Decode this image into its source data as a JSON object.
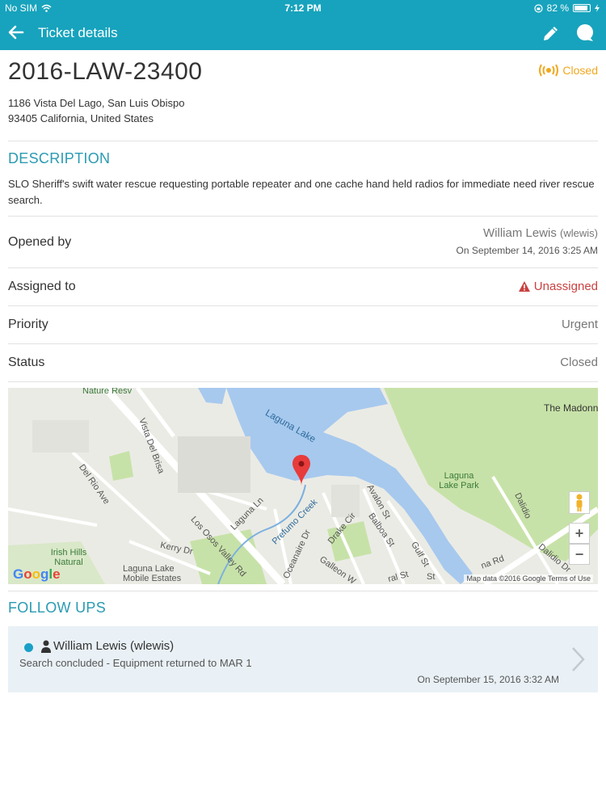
{
  "status_bar": {
    "carrier": "No SIM",
    "time": "7:12 PM",
    "battery": "82 %"
  },
  "app_bar": {
    "title": "Ticket details"
  },
  "ticket": {
    "id": "2016-LAW-23400",
    "status_badge": "Closed",
    "address_line1": "1186 Vista Del Lago, San Luis Obispo",
    "address_line2": "93405 California, United States"
  },
  "description": {
    "title": "DESCRIPTION",
    "text": "SLO Sheriff's swift water rescue requesting portable repeater and one cache hand held radios for immediate need river rescue search."
  },
  "details": {
    "opened_by_label": "Opened by",
    "opened_by_name": "William Lewis",
    "opened_by_handle": "(wlewis)",
    "opened_on": "On September 14, 2016 3:25 AM",
    "assigned_to_label": "Assigned to",
    "assigned_to_value": "Unassigned",
    "priority_label": "Priority",
    "priority_value": "Urgent",
    "status_label": "Status",
    "status_value": "Closed"
  },
  "map": {
    "labels": {
      "nature": "Nature Resv",
      "vista": "Vista Del Brisa",
      "delrio": "Del Rio Ave",
      "laguna_lake": "Laguna Lake",
      "laguna_ln": "Laguna Ln",
      "los_osos": "Los Osos Valley Rd",
      "prefumo": "Prefumo Creek",
      "oceanaire": "Oceanaire Dr",
      "drake": "Drake Cir",
      "avalon": "Avalon St",
      "balboa": "Balboa St",
      "gulf": "Gulf St",
      "galleon": "Galleon W",
      "kerry": "Kerry Dr",
      "irish": "Irish Hills Natural",
      "mobile": "Laguna Lake Mobile Estates",
      "park": "Laguna Lake Park",
      "dalidio": "Dalidio",
      "dalidio2": "Dalidio Dr",
      "madonna": "The Madonn",
      "rd": "na Rd",
      "st1": "ral St",
      "st2": "St"
    },
    "google": "Google",
    "attribution": "Map data ©2016 Google   Terms of Use",
    "zoom_in": "+",
    "zoom_out": "−",
    "colors": {
      "water": "#a7c9ee",
      "park": "#c7e2a8",
      "road": "#ffffff",
      "land": "#ebebe5"
    }
  },
  "followups": {
    "title": "FOLLOW UPS",
    "items": [
      {
        "author": "William Lewis (wlewis)",
        "text": "Search concluded - Equipment returned to MAR 1",
        "date": "On September 15, 2016 3:32 AM"
      }
    ]
  },
  "colors": {
    "accent": "#17a3bd",
    "closed": "#f0a81e",
    "unassigned": "#c94141"
  }
}
